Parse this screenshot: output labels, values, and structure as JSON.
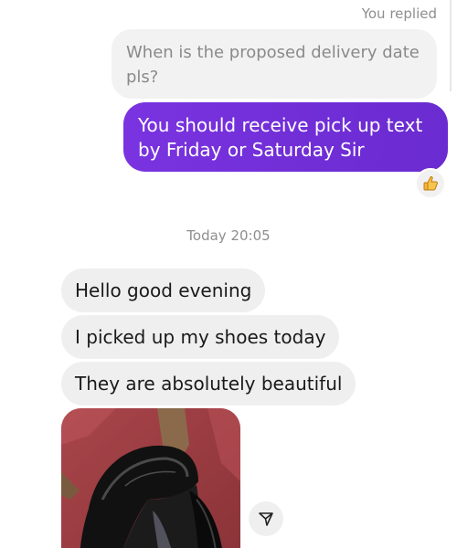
{
  "reply_label": "You replied",
  "quoted_message": "When is the proposed delivery date pls?",
  "sent_message": "You should receive pick up text by Friday or Saturday Sir",
  "reaction_icon": "thumbs-up-icon",
  "timestamp": "Today 20:05",
  "received_messages": [
    "Hello good evening",
    "I picked up my shoes today",
    "They are absolutely beautiful"
  ],
  "share_icon": "paper-plane-icon",
  "colors": {
    "sent_bubble": "#7a33e0",
    "received_bubble": "#efefef",
    "quoted_bubble": "#f2f2f2",
    "meta_text": "#8e8e8e"
  }
}
